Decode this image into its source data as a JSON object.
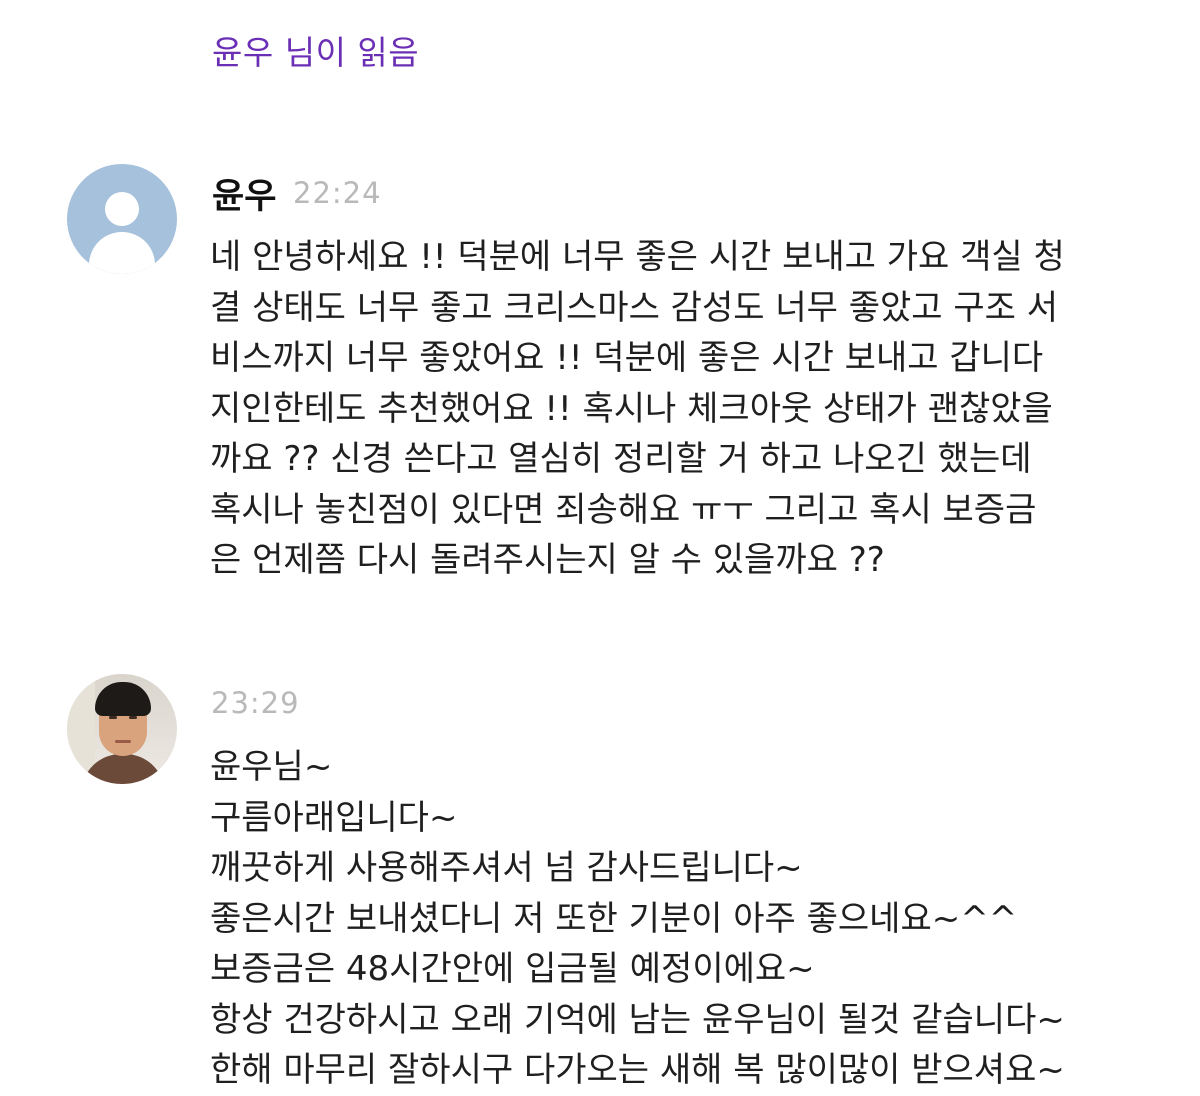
{
  "read_receipt": "윤우 님이 읽음",
  "messages": [
    {
      "avatar": "default-profile-icon",
      "sender": "윤우",
      "time": "22:24",
      "text": "네 안녕하세요 !! 덕분에 너무 좋은 시간 보내고 가요 객실 청결 상태도 너무 좋고 크리스마스 감성도 너무 좋았고 구조 서비스까지 너무 좋았어요 !! 덕분에 좋은 시간 보내고 갑니다 지인한테도 추천했어요 !! 혹시나 체크아웃 상태가 괜찮았을까요 ?? 신경 쓴다고 열심히 정리할 거 하고 나오긴 했는데 혹시나 놓친점이 있다면 죄송해요 ㅠㅜ 그리고 혹시 보증금은 언제쯤 다시 돌려주시는지 알 수 있을까요 ??",
      "lines": [
        "네 안녕하세요 !! 덕분에 너무 좋은 시간 보내고 가요 객실 청",
        "결 상태도 너무 좋고 크리스마스 감성도 너무 좋았고 구조 서",
        "비스까지 너무 좋았어요 !! 덕분에 좋은 시간 보내고 갑니다",
        "지인한테도 추천했어요 !! 혹시나 체크아웃 상태가 괜찮았을",
        "까요 ?? 신경 쓴다고 열심히 정리할 거 하고 나오긴 했는데",
        "혹시나 놓친점이 있다면 죄송해요 ㅠㅜ 그리고 혹시 보증금",
        "은 언제쯤 다시 돌려주시는지 알 수 있을까요 ??"
      ]
    },
    {
      "avatar": "host-profile-photo",
      "time": "23:29",
      "lines": [
        "윤우님~",
        "구름아래입니다~",
        "깨끗하게 사용해주셔서 넘 감사드립니다~",
        "좋은시간 보내셨다니 저 또한 기분이 아주 좋으네요~^^",
        "보증금은 48시간안에 입금될 예정이에요~",
        "항상 건강하시고 오래 기억에 남는 윤우님이 될것 같습니다~",
        "한해 마무리 잘하시구 다가오는 새해 복 많이많이 받으셔요~"
      ]
    }
  ]
}
